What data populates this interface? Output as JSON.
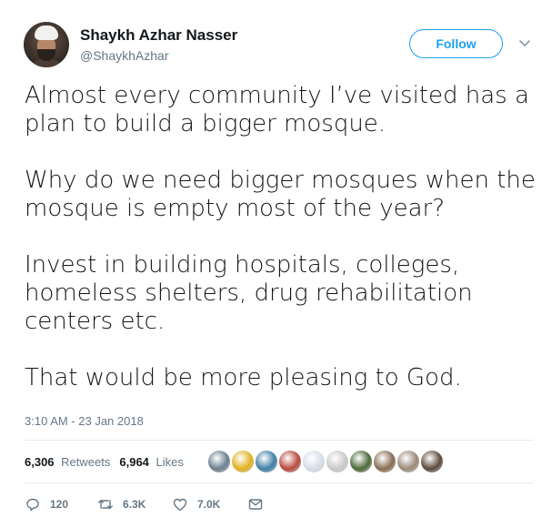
{
  "user": {
    "name": "Shaykh Azhar Nasser",
    "handle": "@ShaykhAzhar"
  },
  "follow_label": "Follow",
  "tweet": {
    "paragraphs": [
      "Almost every community I’ve visited has a plan to build a bigger mosque.",
      "Why do we need bigger mosques when the mosque is empty most of the year?",
      "Invest in building hospitals, colleges, homeless shelters, drug rehabilitation centers etc.",
      "That would be more pleasing to God."
    ],
    "timestamp": "3:10 AM - 23 Jan 2018"
  },
  "stats": {
    "retweets_count": "6,306",
    "retweets_label": "Retweets",
    "likes_count": "6,964",
    "likes_label": "Likes"
  },
  "likers": [
    {
      "color": "#6d7f8f"
    },
    {
      "color": "#e0b21e"
    },
    {
      "color": "#3f7fa6"
    },
    {
      "color": "#b94a3c"
    },
    {
      "color": "#d7dde8"
    },
    {
      "color": "#c9c9c9"
    },
    {
      "color": "#4d6a3a"
    },
    {
      "color": "#8a6d55"
    },
    {
      "color": "#9b8a7a"
    },
    {
      "color": "#5c4a3c"
    }
  ],
  "actions": {
    "replies": "120",
    "retweets": "6.3K",
    "likes": "7.0K"
  },
  "colors": {
    "accent": "#1da1f2",
    "secondary_text": "#657786"
  }
}
